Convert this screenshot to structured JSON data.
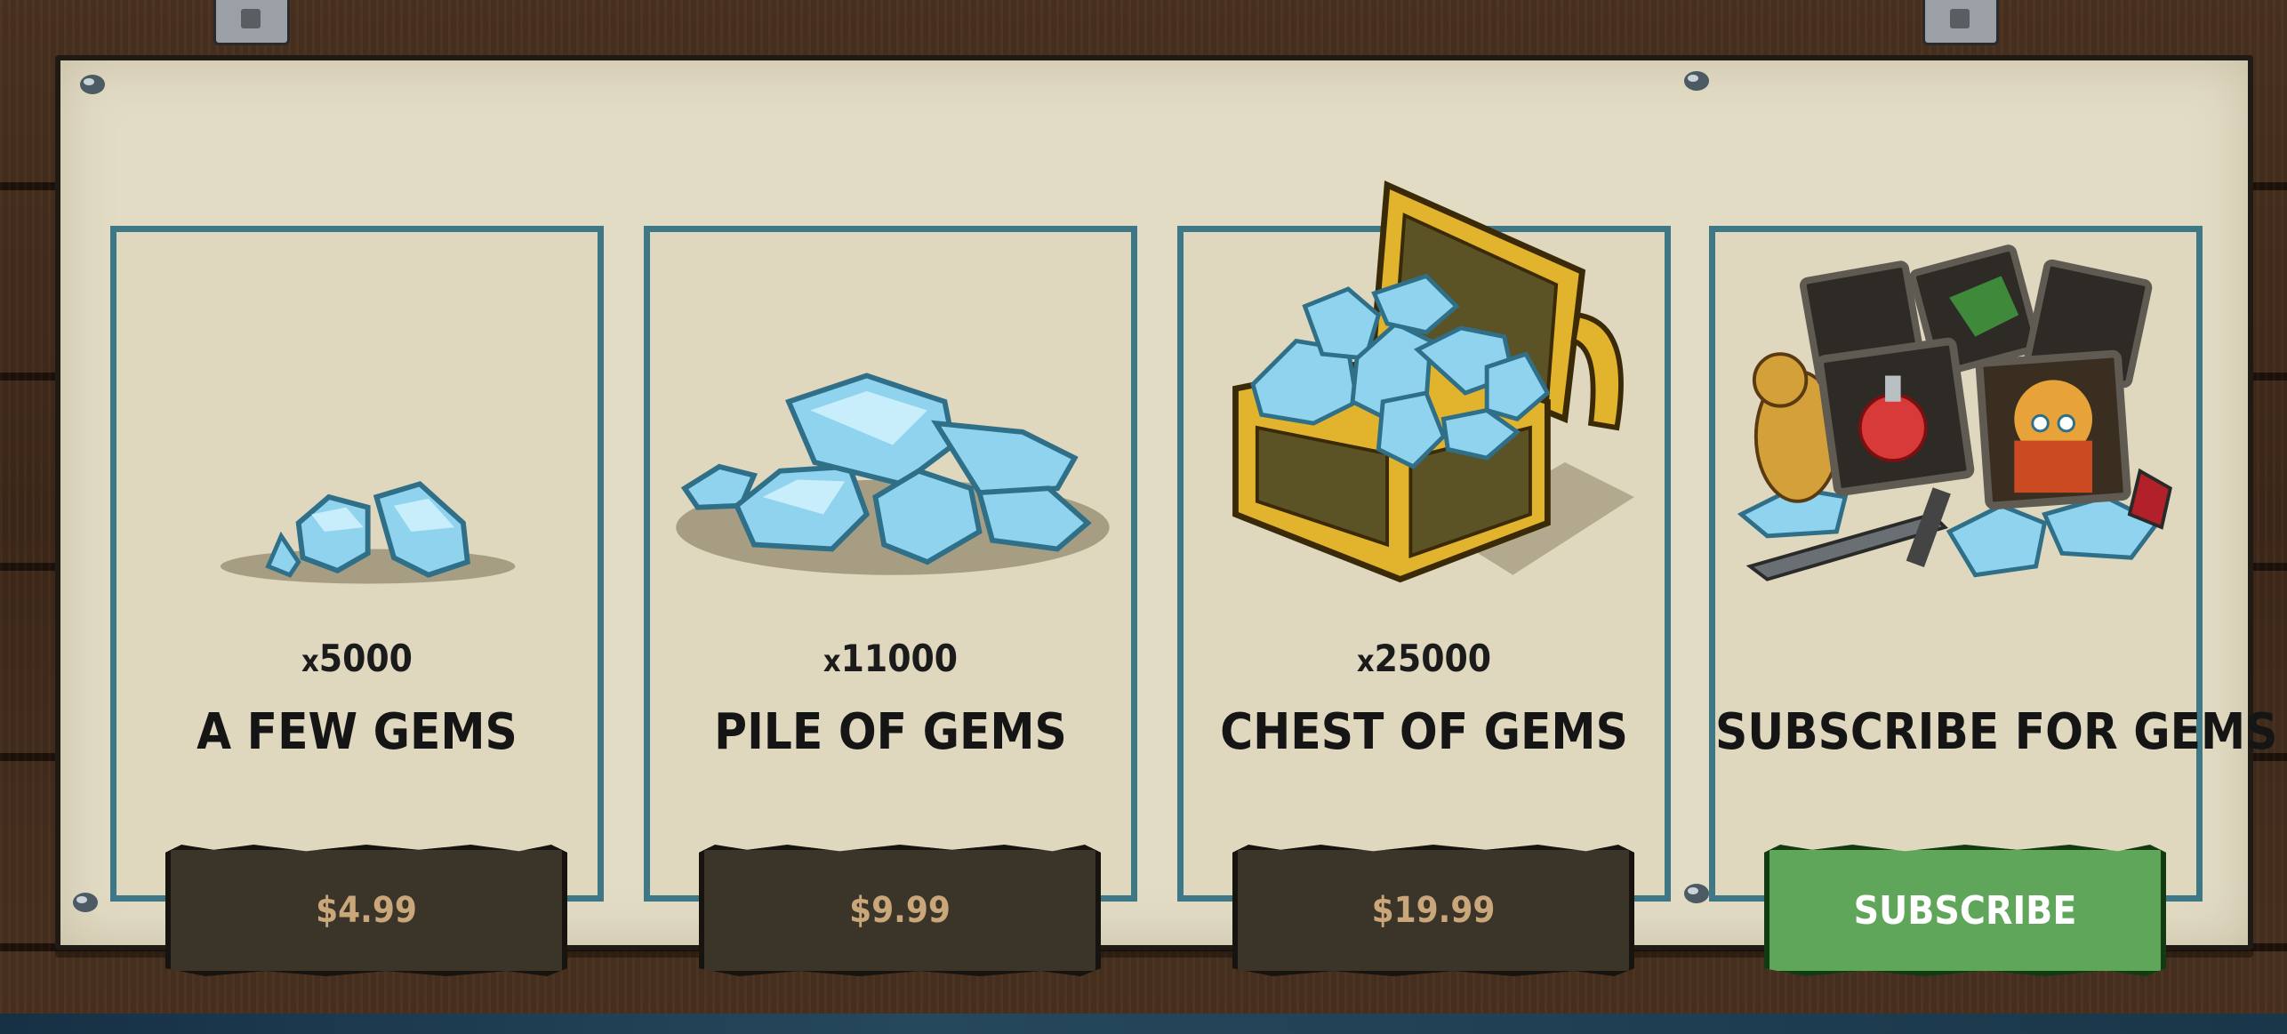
{
  "products": [
    {
      "quantity_prefix": "x",
      "quantity": "5000",
      "title": "A FEW GEMS",
      "button": "$4.99"
    },
    {
      "quantity_prefix": "x",
      "quantity": "11000",
      "title": "PILE OF GEMS",
      "button": "$9.99"
    },
    {
      "quantity_prefix": "x",
      "quantity": "25000",
      "title": "CHEST OF GEMS",
      "button": "$19.99"
    },
    {
      "title": "SUBSCRIBE FOR GEMS",
      "button": "SUBSCRIBE"
    }
  ],
  "colors": {
    "panel": "#e3dcc5",
    "card_border": "#3e7785",
    "price_button": "#3b3429",
    "price_text": "#c9a77a",
    "subscribe_button": "#5fa65a",
    "gem": "#8fd3ef"
  },
  "icons": [
    "small-gems-icon",
    "gem-pile-icon",
    "treasure-chest-icon",
    "subscription-items-icon"
  ]
}
